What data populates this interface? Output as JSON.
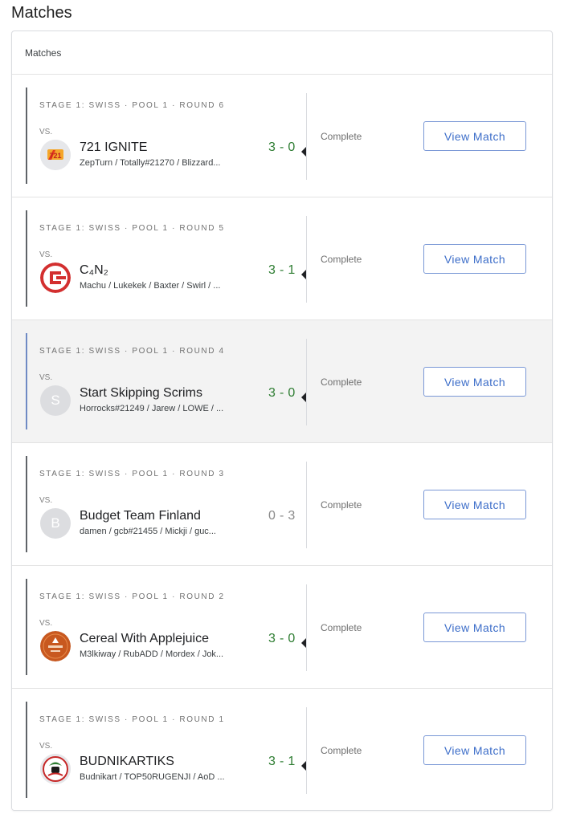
{
  "page": {
    "title": "Matches"
  },
  "card": {
    "header": "Matches"
  },
  "matches": [
    {
      "stage": "STAGE 1: SWISS · POOL 1 · ROUND 6",
      "vs": "VS.",
      "team": "721 IGNITE",
      "roster": "ZepTurn / Totally#21270 / Blizzard...",
      "score": "3 - 0",
      "result": "win",
      "status": "Complete",
      "button": "View Match",
      "avatar": {
        "type": "logo",
        "icon": "721-ignite-logo",
        "color": "#e4572e"
      }
    },
    {
      "stage": "STAGE 1: SWISS · POOL 1 · ROUND 5",
      "vs": "VS.",
      "team": "C₄N₂",
      "roster": "Machu / Lukekek / Baxter / Swirl / ...",
      "score": "3 - 1",
      "result": "win",
      "status": "Complete",
      "button": "View Match",
      "avatar": {
        "type": "logo",
        "icon": "c4n2-logo",
        "color": "#d32f2f"
      }
    },
    {
      "stage": "STAGE 1: SWISS · POOL 1 · ROUND 4",
      "vs": "VS.",
      "team": "Start Skipping Scrims",
      "roster": "Horrocks#21249 / Jarew / LOWE / ...",
      "score": "3 - 0",
      "result": "win",
      "status": "Complete",
      "button": "View Match",
      "highlighted": true,
      "avatar": {
        "type": "letter",
        "letter": "S"
      }
    },
    {
      "stage": "STAGE 1: SWISS · POOL 1 · ROUND 3",
      "vs": "VS.",
      "team": "Budget Team Finland",
      "roster": "damen / gcb#21455 / Mickji / guc...",
      "score": "0 - 3",
      "result": "loss",
      "status": "Complete",
      "button": "View Match",
      "avatar": {
        "type": "letter",
        "letter": "B"
      }
    },
    {
      "stage": "STAGE 1: SWISS · POOL 1 · ROUND 2",
      "vs": "VS.",
      "team": "Cereal With Applejuice",
      "roster": "M3lkiway / RubADD / Mordex / Jok...",
      "score": "3 - 0",
      "result": "win",
      "status": "Complete",
      "button": "View Match",
      "avatar": {
        "type": "logo",
        "icon": "cereal-logo",
        "color": "#c8581f"
      }
    },
    {
      "stage": "STAGE 1: SWISS · POOL 1 · ROUND 1",
      "vs": "VS.",
      "team": "BUDNIKARTIKS",
      "roster": "Budnikart / TOP50RUGENJI / AoD ...",
      "score": "3 - 1",
      "result": "win",
      "status": "Complete",
      "button": "View Match",
      "avatar": {
        "type": "logo",
        "icon": "budnikartiks-logo",
        "color": "#2e7d32"
      }
    }
  ]
}
